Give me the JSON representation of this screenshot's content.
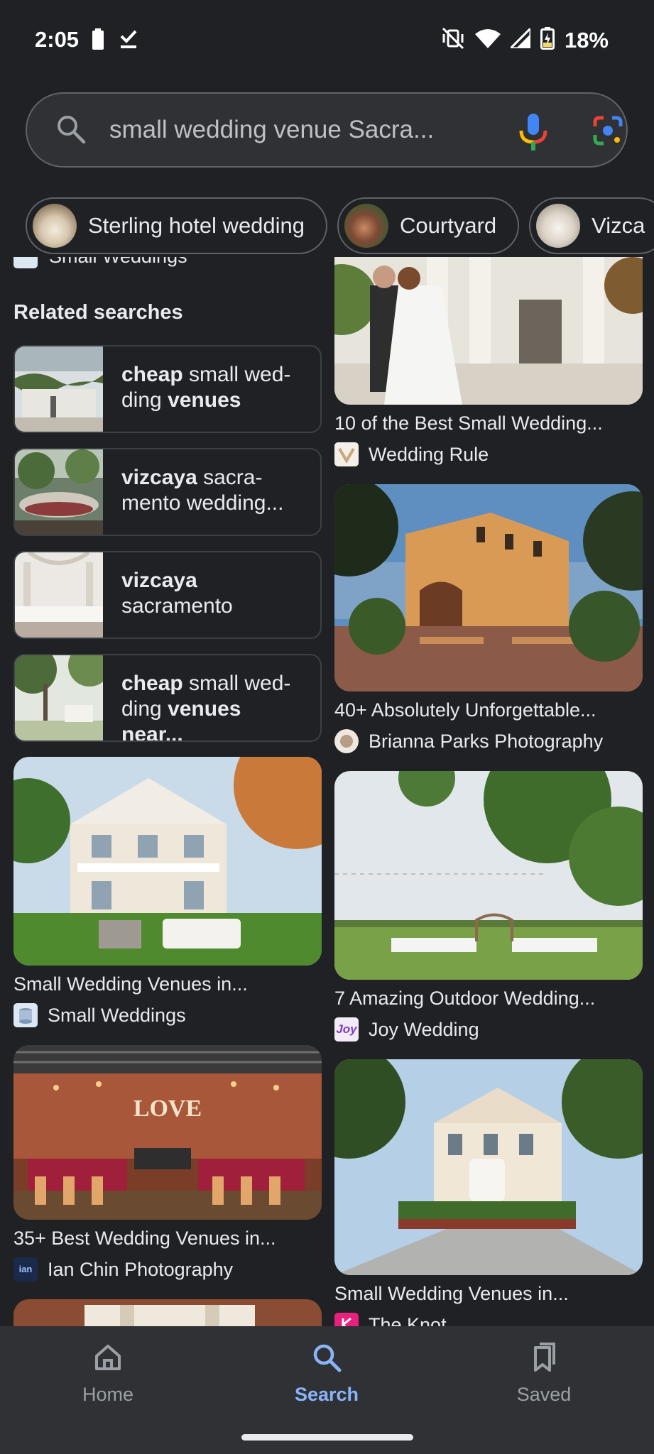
{
  "status_bar": {
    "time": "2:05",
    "battery": "18%"
  },
  "search": {
    "query": "small wedding venue Sacra...",
    "icons": [
      "search-icon",
      "mic-icon",
      "google-lens-icon"
    ]
  },
  "chips": [
    {
      "label": "Sterling hotel wedding"
    },
    {
      "label": "Courtyard"
    },
    {
      "label": "Vizca"
    }
  ],
  "peek": {
    "source": "Small Weddings"
  },
  "related": {
    "title": "Related searches",
    "items": [
      {
        "bold1": "cheap",
        "rest1": " small wed-",
        "line2_plain": "ding ",
        "bold2": "venues",
        "rest2": ""
      },
      {
        "bold1": "vizcaya",
        "rest1": " sacra-",
        "line2_plain": "mento wedding...",
        "bold2": "",
        "rest2": ""
      },
      {
        "bold1": "vizcaya",
        "rest1": "",
        "line2_plain": "sacramento",
        "bold2": "",
        "rest2": ""
      },
      {
        "bold1": "cheap",
        "rest1": " small wed-",
        "line2_plain": "ding ",
        "bold2": "venues near...",
        "rest2": ""
      }
    ]
  },
  "results_left": [
    {
      "title": "Small Wedding Venues in...",
      "source": "Small Weddings"
    },
    {
      "title": "35+ Best Wedding Venues in...",
      "source": "Ian Chin Photography",
      "fav_text": "ian"
    }
  ],
  "results_right": [
    {
      "title": "10 of the Best Small Wedding...",
      "source": "Wedding Rule"
    },
    {
      "title": "40+ Absolutely Unforgettable...",
      "source": "Brianna Parks Photography"
    },
    {
      "title": "7 Amazing Outdoor Wedding...",
      "source": "Joy Wedding",
      "fav_text": "Joy"
    },
    {
      "title": "Small Wedding Venues in...",
      "source": "The Knot"
    }
  ],
  "nav": [
    {
      "label": "Home"
    },
    {
      "label": "Search"
    },
    {
      "label": "Saved"
    }
  ]
}
